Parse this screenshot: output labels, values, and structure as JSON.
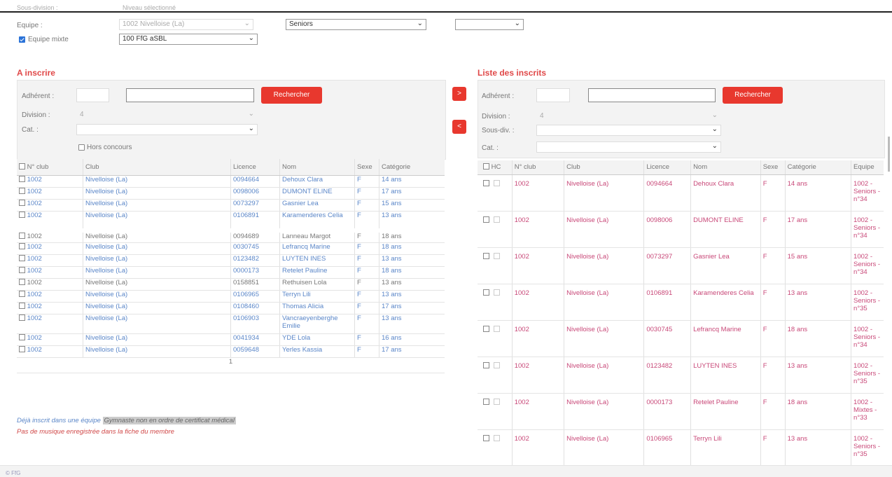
{
  "header": {
    "cut_left": "Sous-division :",
    "cut_right": "Niveau sélectionné"
  },
  "filters": {
    "equipe_label": "Equipe :",
    "equipe_value": "1002 Nivelloise (La)",
    "seniors_value": "Seniors",
    "blank_select_value": "",
    "mixte_label": "Equipe mixte",
    "mixte_checked": true,
    "program_value": "100 FfG aSBL"
  },
  "left": {
    "title": "A inscrire",
    "adherent_label": "Adhérent :",
    "search_button": "Rechercher",
    "division_label": "Division :",
    "division_value": "4",
    "cat_label": "Cat. :",
    "cat_value": "",
    "hors_concours_label": "Hors concours",
    "columns": [
      "N° club",
      "Club",
      "Licence",
      "Nom",
      "Sexe",
      "Catégorie"
    ],
    "rows": [
      {
        "club_no": "1002",
        "club": "Nivelloise (La)",
        "licence": "0094664",
        "nom": "Dehoux Clara",
        "sexe": "F",
        "cat": "14 ans",
        "style": "blue"
      },
      {
        "club_no": "1002",
        "club": "Nivelloise (La)",
        "licence": "0098006",
        "nom": "DUMONT ELINE",
        "sexe": "F",
        "cat": "17 ans",
        "style": "blue"
      },
      {
        "club_no": "1002",
        "club": "Nivelloise (La)",
        "licence": "0073297",
        "nom": "Gasnier Lea",
        "sexe": "F",
        "cat": "15 ans",
        "style": "blue"
      },
      {
        "club_no": "1002",
        "club": "Nivelloise (La)",
        "licence": "0106891",
        "nom": "Karamenderes Celia",
        "sexe": "F",
        "cat": "13 ans",
        "style": "blue"
      },
      {
        "club_no": "1002",
        "club": "Nivelloise (La)",
        "licence": "0094689",
        "nom": "Lanneau Margot",
        "sexe": "F",
        "cat": "18 ans",
        "style": "gray"
      },
      {
        "club_no": "1002",
        "club": "Nivelloise (La)",
        "licence": "0030745",
        "nom": "Lefrancq Marine",
        "sexe": "F",
        "cat": "18 ans",
        "style": "blue"
      },
      {
        "club_no": "1002",
        "club": "Nivelloise (La)",
        "licence": "0123482",
        "nom": "LUYTEN INES",
        "sexe": "F",
        "cat": "13 ans",
        "style": "blue"
      },
      {
        "club_no": "1002",
        "club": "Nivelloise (La)",
        "licence": "0000173",
        "nom": "Retelet Pauline",
        "sexe": "F",
        "cat": "18 ans",
        "style": "blue"
      },
      {
        "club_no": "1002",
        "club": "Nivelloise (La)",
        "licence": "0158851",
        "nom": "Rethuisen Lola",
        "sexe": "F",
        "cat": "13 ans",
        "style": "gray"
      },
      {
        "club_no": "1002",
        "club": "Nivelloise (La)",
        "licence": "0106965",
        "nom": "Terryn Lili",
        "sexe": "F",
        "cat": "13 ans",
        "style": "blue"
      },
      {
        "club_no": "1002",
        "club": "Nivelloise (La)",
        "licence": "0108460",
        "nom": "Thomas Alicia",
        "sexe": "F",
        "cat": "17 ans",
        "style": "blue"
      },
      {
        "club_no": "1002",
        "club": "Nivelloise (La)",
        "licence": "0106903",
        "nom": "Vancraeyenberghe Emilie",
        "sexe": "F",
        "cat": "13 ans",
        "style": "blue"
      },
      {
        "club_no": "1002",
        "club": "Nivelloise (La)",
        "licence": "0041934",
        "nom": "YDE Lola",
        "sexe": "F",
        "cat": "16 ans",
        "style": "blue"
      },
      {
        "club_no": "1002",
        "club": "Nivelloise (La)",
        "licence": "0059648",
        "nom": "Yerles Kassia",
        "sexe": "F",
        "cat": "17 ans",
        "style": "blue"
      }
    ],
    "page": "1"
  },
  "arrows": {
    "add": ">",
    "remove": "<"
  },
  "right": {
    "title": "Liste des inscrits",
    "adherent_label": "Adhérent :",
    "search_button": "Rechercher",
    "division_label": "Division :",
    "division_value": "4",
    "sousdiv_label": "Sous-div. :",
    "sousdiv_value": "",
    "cat_label": "Cat. :",
    "cat_value": "",
    "columns": [
      "HC",
      "N° club",
      "Club",
      "Licence",
      "Nom",
      "Sexe",
      "Catégorie",
      "Equipe"
    ],
    "rows": [
      {
        "club_no": "1002",
        "club": "Nivelloise (La)",
        "licence": "0094664",
        "nom": "Dehoux Clara",
        "sexe": "F",
        "cat": "14 ans",
        "equipe": "1002 - Seniors - n°34"
      },
      {
        "club_no": "1002",
        "club": "Nivelloise (La)",
        "licence": "0098006",
        "nom": "DUMONT ELINE",
        "sexe": "F",
        "cat": "17 ans",
        "equipe": "1002 - Seniors - n°34"
      },
      {
        "club_no": "1002",
        "club": "Nivelloise (La)",
        "licence": "0073297",
        "nom": "Gasnier Lea",
        "sexe": "F",
        "cat": "15 ans",
        "equipe": "1002 - Seniors - n°34"
      },
      {
        "club_no": "1002",
        "club": "Nivelloise (La)",
        "licence": "0106891",
        "nom": "Karamenderes Celia",
        "sexe": "F",
        "cat": "13 ans",
        "equipe": "1002 - Seniors - n°35"
      },
      {
        "club_no": "1002",
        "club": "Nivelloise (La)",
        "licence": "0030745",
        "nom": "Lefrancq Marine",
        "sexe": "F",
        "cat": "18 ans",
        "equipe": "1002 - Seniors - n°34"
      },
      {
        "club_no": "1002",
        "club": "Nivelloise (La)",
        "licence": "0123482",
        "nom": "LUYTEN INES",
        "sexe": "F",
        "cat": "13 ans",
        "equipe": "1002 - Seniors - n°35"
      },
      {
        "club_no": "1002",
        "club": "Nivelloise (La)",
        "licence": "0000173",
        "nom": "Retelet Pauline",
        "sexe": "F",
        "cat": "18 ans",
        "equipe": "1002 - Mixtes - n°33"
      },
      {
        "club_no": "1002",
        "club": "Nivelloise (La)",
        "licence": "0106965",
        "nom": "Terryn Lili",
        "sexe": "F",
        "cat": "13 ans",
        "equipe": "1002 - Seniors - n°35"
      }
    ]
  },
  "notes": {
    "already_in_team": "Déjà inscrit dans une équipe",
    "certificate": "Gymnaste non en ordre de certificat médical",
    "no_music": "Pas de musique enregistrée dans la fiche du membre"
  },
  "footer": {
    "text": "© FfG"
  }
}
